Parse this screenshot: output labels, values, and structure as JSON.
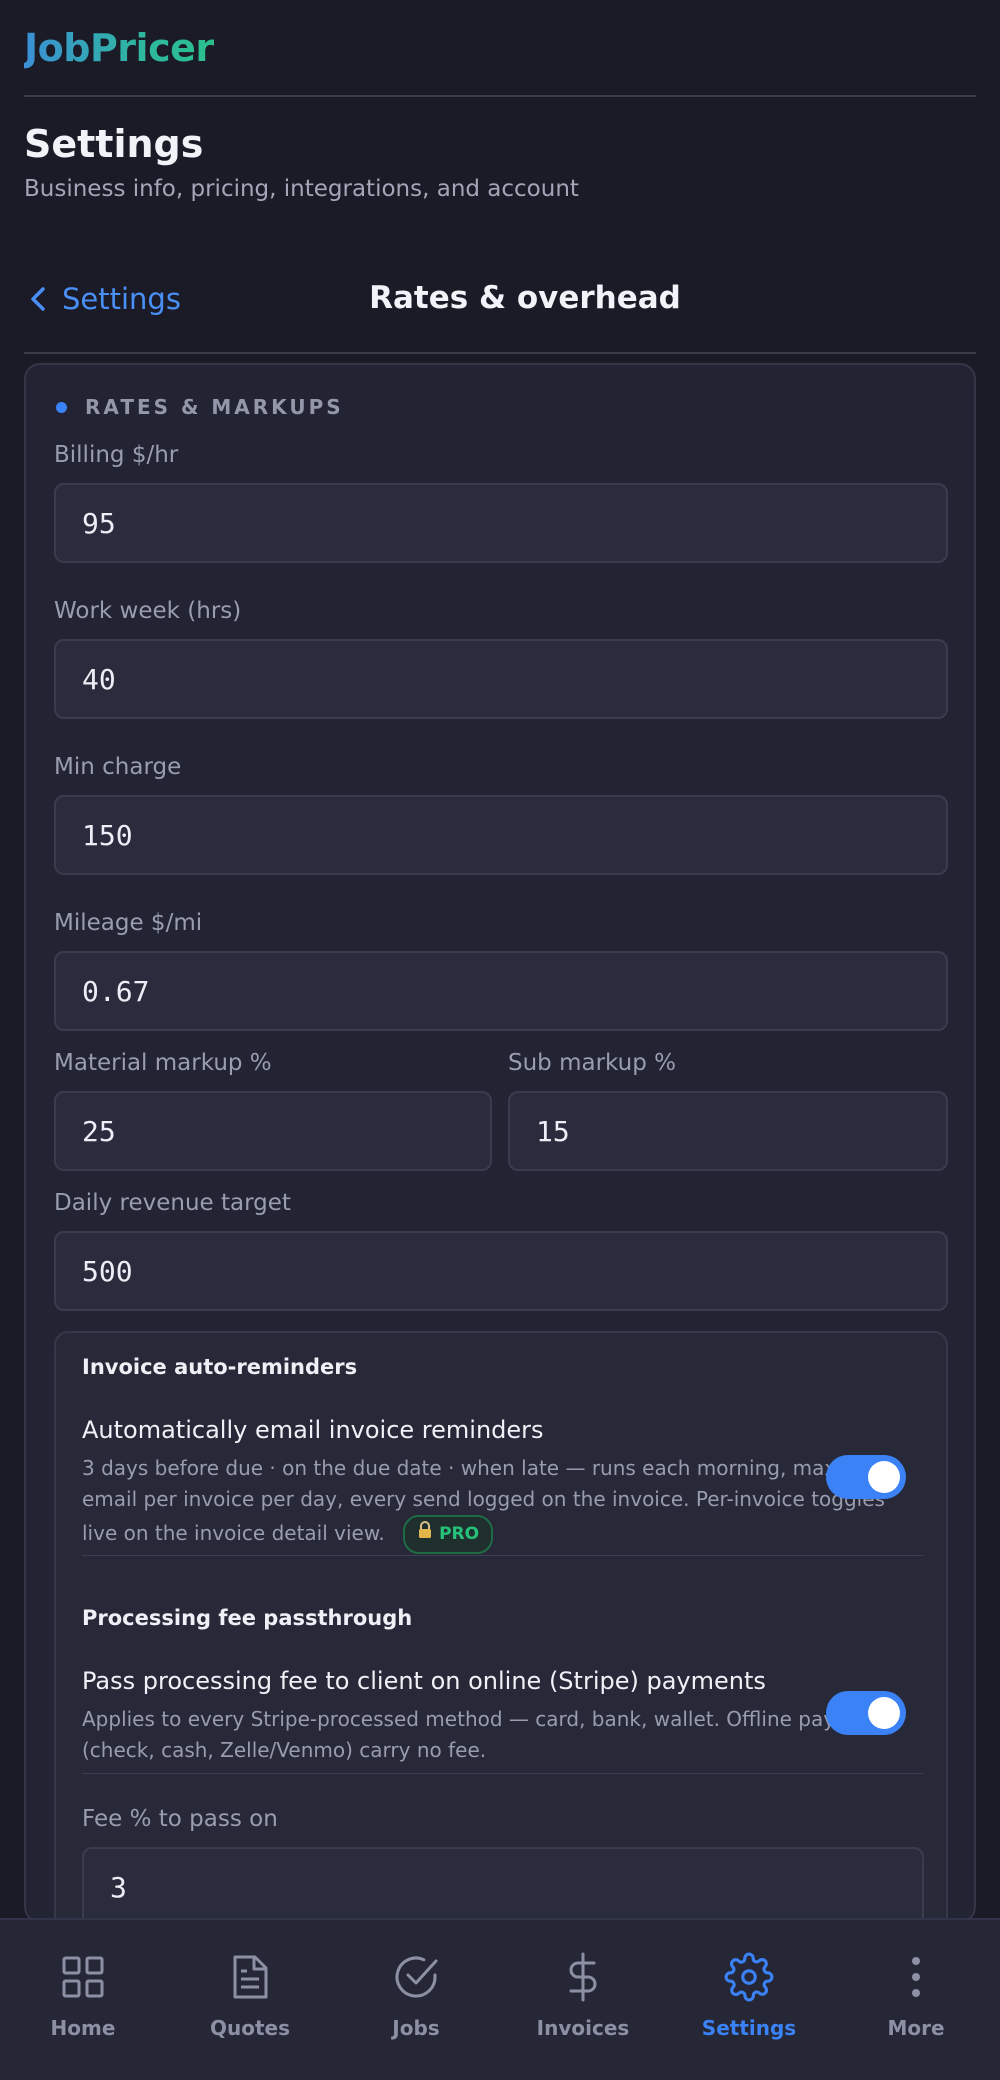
{
  "app": {
    "name": "JobPricer"
  },
  "page": {
    "title": "Settings",
    "subtitle": "Business info, pricing, integrations, and account"
  },
  "subnav": {
    "back_label": "Settings",
    "title": "Rates & overhead"
  },
  "section": {
    "title": "RATES & MARKUPS"
  },
  "fields": {
    "billing": {
      "label": "Billing $/hr",
      "value": "95"
    },
    "work_week": {
      "label": "Work week (hrs)",
      "value": "40"
    },
    "min_charge": {
      "label": "Min charge",
      "value": "150"
    },
    "mileage": {
      "label": "Mileage $/mi",
      "value": "0.67"
    },
    "material_markup": {
      "label": "Material markup %",
      "value": "25"
    },
    "sub_markup": {
      "label": "Sub markup %",
      "value": "15"
    },
    "daily_target": {
      "label": "Daily revenue target",
      "value": "500"
    }
  },
  "reminders": {
    "heading": "Invoice auto-reminders",
    "title": "Automatically email invoice reminders",
    "desc_line1": "3 days before due · on the due date · when late — runs each morning, max one",
    "desc_line2": "email per invoice per day, every send logged on the invoice. Per-invoice toggles",
    "desc_line3": "live on the invoice detail view.",
    "badge": "PRO",
    "enabled": true
  },
  "fee": {
    "heading": "Processing fee passthrough",
    "title": "Pass processing fee to client on online (Stripe) payments",
    "desc_line1": "Applies to every Stripe-processed method — card, bank, wallet. Offline payments",
    "desc_line2": "(check, cash, Zelle/Venmo) carry no fee.",
    "enabled": true,
    "pct_label": "Fee % to pass on",
    "pct_value": "3"
  },
  "nav": {
    "home": "Home",
    "quotes": "Quotes",
    "jobs": "Jobs",
    "invoices": "Invoices",
    "settings": "Settings",
    "more": "More",
    "active": "settings"
  },
  "colors": {
    "accent": "#3b82f6",
    "pro_green": "#27c27a",
    "background": "#1a1b26"
  }
}
